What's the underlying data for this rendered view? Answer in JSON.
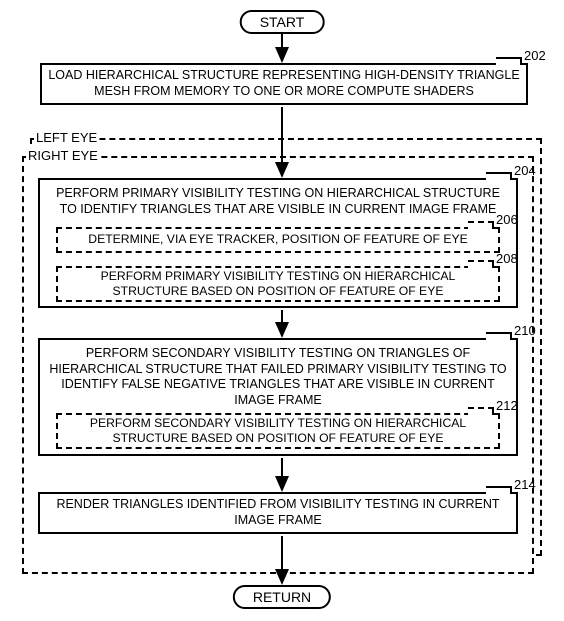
{
  "chart_data": {
    "type": "flowchart",
    "nodes": [
      {
        "id": "start",
        "kind": "terminal",
        "label": "START"
      },
      {
        "id": "n202",
        "kind": "process",
        "ref": "202",
        "label": "LOAD HIERARCHICAL STRUCTURE REPRESENTING HIGH-DENSITY TRIANGLE MESH FROM MEMORY TO ONE OR MORE COMPUTE SHADERS"
      },
      {
        "id": "leftEye",
        "kind": "dashed-group",
        "label": "LEFT EYE"
      },
      {
        "id": "rightEye",
        "kind": "dashed-group",
        "label": "RIGHT EYE",
        "parent": "leftEye"
      },
      {
        "id": "n204",
        "kind": "process",
        "parent": "rightEye",
        "ref": "204",
        "label": "PERFORM PRIMARY VISIBILITY TESTING ON HIERARCHICAL STRUCTURE TO IDENTIFY TRIANGLES THAT ARE VISIBLE IN CURRENT IMAGE FRAME"
      },
      {
        "id": "n206",
        "kind": "subprocess",
        "parent": "n204",
        "ref": "206",
        "label": "DETERMINE, VIA EYE TRACKER, POSITION OF FEATURE OF EYE"
      },
      {
        "id": "n208",
        "kind": "subprocess",
        "parent": "n204",
        "ref": "208",
        "label": "PERFORM PRIMARY VISIBILITY TESTING ON HIERARCHICAL STRUCTURE BASED ON POSITION OF FEATURE OF EYE"
      },
      {
        "id": "n210",
        "kind": "process",
        "parent": "rightEye",
        "ref": "210",
        "label": "PERFORM SECONDARY VISIBILITY TESTING ON TRIANGLES OF HIERARCHICAL STRUCTURE THAT FAILED PRIMARY VISIBILITY TESTING TO IDENTIFY FALSE NEGATIVE TRIANGLES THAT ARE VISIBLE IN CURRENT IMAGE FRAME"
      },
      {
        "id": "n212",
        "kind": "subprocess",
        "parent": "n210",
        "ref": "212",
        "label": "PERFORM SECONDARY VISIBILITY TESTING ON HIERARCHICAL STRUCTURE BASED ON POSITION OF FEATURE OF EYE"
      },
      {
        "id": "n214",
        "kind": "process",
        "parent": "rightEye",
        "ref": "214",
        "label": "RENDER TRIANGLES IDENTIFIED FROM VISIBILITY TESTING IN CURRENT IMAGE FRAME"
      },
      {
        "id": "return",
        "kind": "terminal",
        "label": "RETURN"
      }
    ],
    "edges": [
      [
        "start",
        "n202"
      ],
      [
        "n202",
        "n204"
      ],
      [
        "n204",
        "n210"
      ],
      [
        "n210",
        "n214"
      ],
      [
        "n214",
        "return"
      ]
    ]
  },
  "t": {
    "start": "START",
    "return": "RETURN",
    "leftEye": "LEFT EYE",
    "rightEye": "RIGHT EYE",
    "r202": "202",
    "r204": "204",
    "r206": "206",
    "r208": "208",
    "r210": "210",
    "r212": "212",
    "r214": "214",
    "n202": "LOAD HIERARCHICAL STRUCTURE REPRESENTING HIGH-DENSITY TRIANGLE MESH FROM MEMORY TO ONE OR MORE COMPUTE SHADERS",
    "n204": "PERFORM PRIMARY VISIBILITY TESTING ON HIERARCHICAL STRUCTURE TO IDENTIFY TRIANGLES THAT ARE VISIBLE IN CURRENT IMAGE FRAME",
    "n206": "DETERMINE, VIA EYE TRACKER, POSITION OF FEATURE OF EYE",
    "n208": "PERFORM PRIMARY VISIBILITY TESTING ON HIERARCHICAL STRUCTURE BASED ON POSITION OF FEATURE OF EYE",
    "n210": "PERFORM SECONDARY VISIBILITY TESTING ON TRIANGLES OF HIERARCHICAL STRUCTURE THAT FAILED PRIMARY VISIBILITY TESTING TO IDENTIFY FALSE NEGATIVE TRIANGLES THAT ARE VISIBLE IN CURRENT IMAGE FRAME",
    "n212": "PERFORM SECONDARY VISIBILITY TESTING ON HIERARCHICAL STRUCTURE BASED ON POSITION OF FEATURE OF EYE",
    "n214": "RENDER TRIANGLES IDENTIFIED FROM VISIBILITY TESTING IN CURRENT IMAGE FRAME"
  }
}
